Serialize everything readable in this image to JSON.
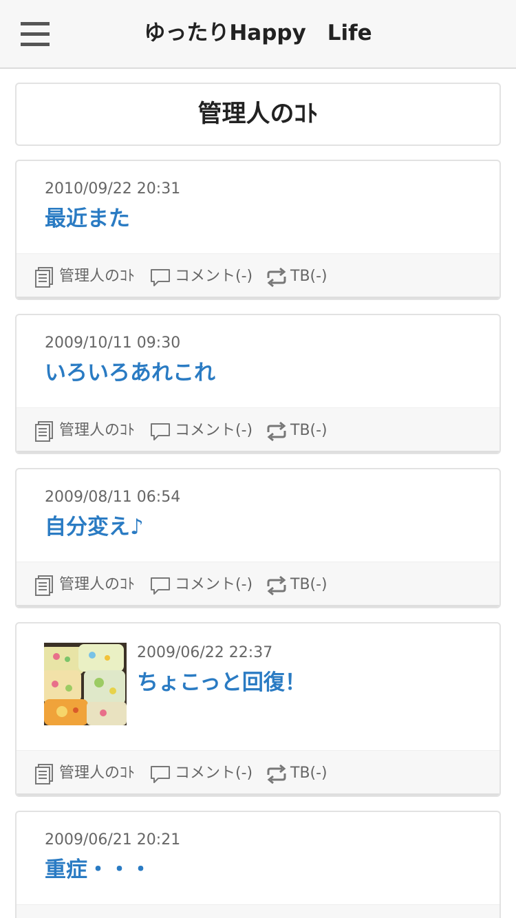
{
  "header": {
    "title": "ゆったりHappy　Life",
    "menu_icon": "hamburger-menu-icon"
  },
  "category": {
    "title": "管理人のｺﾄ"
  },
  "entries": [
    {
      "date": "2010/09/22 20:31",
      "title": "最近また",
      "category": "管理人のｺﾄ",
      "comments": "コメント(-)",
      "trackbacks": "TB(-)"
    },
    {
      "date": "2009/10/11 09:30",
      "title": "いろいろあれこれ",
      "category": "管理人のｺﾄ",
      "comments": "コメント(-)",
      "trackbacks": "TB(-)"
    },
    {
      "date": "2009/08/11 06:54",
      "title": "自分変え♪",
      "category": "管理人のｺﾄ",
      "comments": "コメント(-)",
      "trackbacks": "TB(-)"
    },
    {
      "date": "2009/06/22 22:37",
      "title": "ちょこっと回復！",
      "category": "管理人のｺﾄ",
      "comments": "コメント(-)",
      "trackbacks": "TB(-)",
      "thumbnail": "lunch-boxes-photo"
    },
    {
      "date": "2009/06/21 20:21",
      "title": "重症・・・"
    }
  ],
  "colors": {
    "link": "#2a7bc3",
    "header_bg": "#f7f7f7",
    "footer_bg": "#f7f7f7",
    "border": "#e2e2e2"
  }
}
